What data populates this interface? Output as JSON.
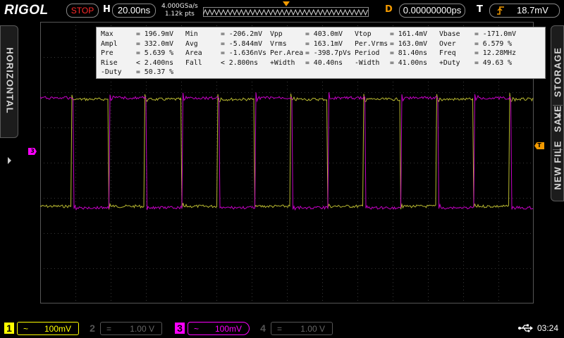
{
  "top": {
    "brand": "RIGOL",
    "run_status": "STOP",
    "h_label": "H",
    "timebase": "20.00ns",
    "sample_rate": "4.000GSa/s",
    "memory_depth": "1.12k pts",
    "d_label": "D",
    "delay": "0.00000000ps",
    "t_label": "T",
    "trigger_level": "18.7mV",
    "trigger_icon": "rising-edge-icon"
  },
  "left_tab": {
    "label": "HORIZONTAL"
  },
  "right_tab": {
    "storage": "STORAGE",
    "save": "SAVE",
    "new_file": "NEW FILE"
  },
  "measurements": [
    [
      {
        "name": "Max",
        "value": "= 196.9mV"
      },
      {
        "name": "Min",
        "value": "= -206.2mV"
      },
      {
        "name": "Vpp",
        "value": "= 403.0mV"
      },
      {
        "name": "Vtop",
        "value": "= 161.4mV"
      },
      {
        "name": "Vbase",
        "value": "= -171.0mV"
      }
    ],
    [
      {
        "name": "Ampl",
        "value": "= 332.0mV"
      },
      {
        "name": "Avg",
        "value": "= -5.844mV"
      },
      {
        "name": "Vrms",
        "value": "= 163.1mV"
      },
      {
        "name": "Per.Vrms",
        "value": "= 163.0mV"
      },
      {
        "name": "Over",
        "value": "= 6.579 %"
      }
    ],
    [
      {
        "name": "Pre",
        "value": "= 5.639 %"
      },
      {
        "name": "Area",
        "value": "= -1.636nVs"
      },
      {
        "name": "Per.Area",
        "value": "= -398.7pVs"
      },
      {
        "name": "Period",
        "value": "= 81.40ns"
      },
      {
        "name": "Freq",
        "value": "= 12.28MHz"
      }
    ],
    [
      {
        "name": "Rise",
        "value": "< 2.400ns"
      },
      {
        "name": "Fall",
        "value": "< 2.800ns"
      },
      {
        "name": "+Width",
        "value": "= 40.40ns"
      },
      {
        "name": "-Width",
        "value": "= 41.00ns"
      },
      {
        "name": "+Duty",
        "value": "= 49.63 %"
      }
    ],
    [
      {
        "name": "-Duty",
        "value": "= 50.37 %"
      }
    ]
  ],
  "markers": {
    "ch3": "3",
    "trigger": "T"
  },
  "channels": [
    {
      "num": "1",
      "coupling": "~",
      "scale": "100mV",
      "active": true,
      "color": "#ffff00"
    },
    {
      "num": "2",
      "coupling": "=",
      "scale": "1.00 V",
      "active": false,
      "color": "#555555"
    },
    {
      "num": "3",
      "coupling": "~",
      "scale": "100mV",
      "active": true,
      "color": "#ff00ff"
    },
    {
      "num": "4",
      "coupling": "=",
      "scale": "1.00 V",
      "active": false,
      "color": "#555555"
    }
  ],
  "status": {
    "time": "03:24",
    "usb_icon": "usb-icon"
  },
  "colors": {
    "ch1": "#b8b830",
    "ch3": "#c400c4",
    "accent": "#f39a00",
    "stop": "#ff2a2a"
  }
}
